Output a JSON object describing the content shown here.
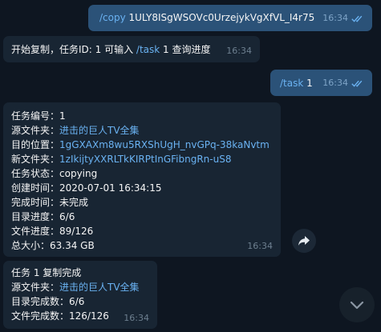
{
  "messages": [
    {
      "side": "out",
      "cmd": "/copy",
      "text": " 1ULY8ISgWSOVc0UrzejykVgXfVL_I4r75",
      "time": "16:34"
    },
    {
      "side": "in",
      "text_a": "开始复制，任务ID: 1 可输入 ",
      "link": "/task",
      "text_b": " 1 查询进度",
      "time": "16:34"
    },
    {
      "side": "out",
      "cmd": "/task",
      "text": " 1",
      "time": "16:34"
    },
    {
      "side": "in",
      "lines": [
        {
          "label": "任务编号：",
          "value": "1",
          "link": false
        },
        {
          "label": "源文件夹：",
          "value": "进击的巨人TV全集",
          "link": true
        },
        {
          "label": "目的位置：",
          "value": "1gGXAXm8wu5RXShUgH_nvGPq-38kaNvtm",
          "link": true
        },
        {
          "label": "新文件夹：",
          "value": "1zIkijtyXXRLTkKIRPtInGFibngRn-uS8",
          "link": true
        },
        {
          "label": "任务状态：",
          "value": "copying",
          "link": false
        },
        {
          "label": "创建时间：",
          "value": "2020-07-01 16:34:15",
          "link": false
        },
        {
          "label": "完成时间：",
          "value": "未完成",
          "link": false
        },
        {
          "label": "目录进度：",
          "value": "6/6",
          "link": false
        },
        {
          "label": "文件进度：",
          "value": "89/126",
          "link": false
        },
        {
          "label": "总大小：",
          "value": "63.34 GB",
          "link": false
        }
      ],
      "time": "16:34"
    },
    {
      "side": "in",
      "title": "任务 1 复制完成",
      "lines": [
        {
          "label": "源文件夹：",
          "value": "进击的巨人TV全集",
          "link": true
        },
        {
          "label": "目录完成数：",
          "value": "6/6",
          "link": false
        },
        {
          "label": "文件完成数：",
          "value": "126/126",
          "link": false
        }
      ],
      "time": "16:34"
    }
  ],
  "icons": {
    "forward": "forward-arrow-icon",
    "scroll_down": "chevron-down-icon",
    "read_receipt": "double-check-icon"
  },
  "colors": {
    "background": "#0e1621",
    "outgoing_bubble": "#2b5278",
    "incoming_bubble": "#182533",
    "link": "#6ab2f2",
    "read_check": "#6ab2f2"
  }
}
